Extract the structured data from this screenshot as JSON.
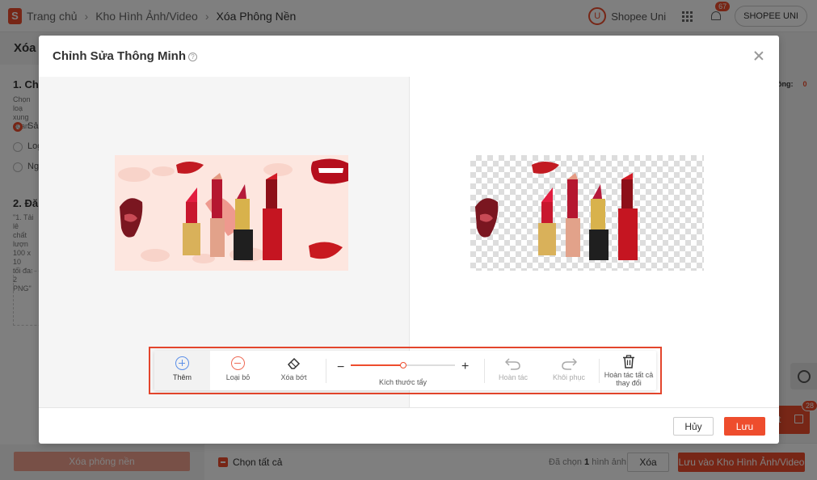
{
  "header": {
    "logo_letter": "S",
    "breadcrumb": [
      "Trang chủ",
      "Kho Hình Ảnh/Video",
      "Xóa Phông Nền"
    ],
    "uni_icon_text": "U",
    "uni_label": "Shopee Uni",
    "notification_count": "67",
    "shop_button": "SHOPEE UNI"
  },
  "background_page": {
    "title": "Xóa P",
    "step1_title": "1. Chọ",
    "step1_text": "Chọn loạ\nxung quan",
    "radio_options": [
      "Sả",
      "Log",
      "Ngư"
    ],
    "step2_title": "2. Đăn",
    "step2_text": "\"1. Tải lê\nchất lượn\n100 x 10\ntối đa: 2\nPNG\"",
    "right_count_label": "ông:",
    "right_count_value": "0",
    "remove_bg_button": "Xóa phông nền",
    "select_all": "Chọn tất cả",
    "selected_prefix": "Đã chọn",
    "selected_count": "1",
    "selected_suffix": "hình ảnh",
    "delete_button": "Xóa",
    "save_library_button": "Lưu vào Kho Hình Ảnh/Video",
    "chat_tab_text": "t",
    "chat_badge": "28"
  },
  "modal": {
    "title": "Chỉnh Sửa Thông Minh",
    "help_icon": "?",
    "tools": {
      "add": "Thêm",
      "remove": "Loại bỏ",
      "erase": "Xóa bớt",
      "undo": "Hoàn tác",
      "redo": "Khôi phục",
      "undo_all": "Hoàn tác tất cả thay đổi"
    },
    "slider": {
      "label": "Kích thước tẩy",
      "minus": "−",
      "plus": "+",
      "value_fraction": 0.5
    },
    "cancel_button": "Hủy",
    "save_button": "Lưu"
  },
  "colors": {
    "accent": "#ee4d2d",
    "add_blue": "#5b8fe8",
    "remove_red": "#ee6a55"
  },
  "icons": [
    "shopee-logo-icon",
    "chevron-right-icon",
    "shopee-uni-icon",
    "apps-grid-icon",
    "bell-icon",
    "help-icon",
    "close-icon",
    "plus-circle-icon",
    "minus-circle-icon",
    "eraser-icon",
    "undo-icon",
    "redo-icon",
    "trash-icon",
    "chat-icon"
  ]
}
